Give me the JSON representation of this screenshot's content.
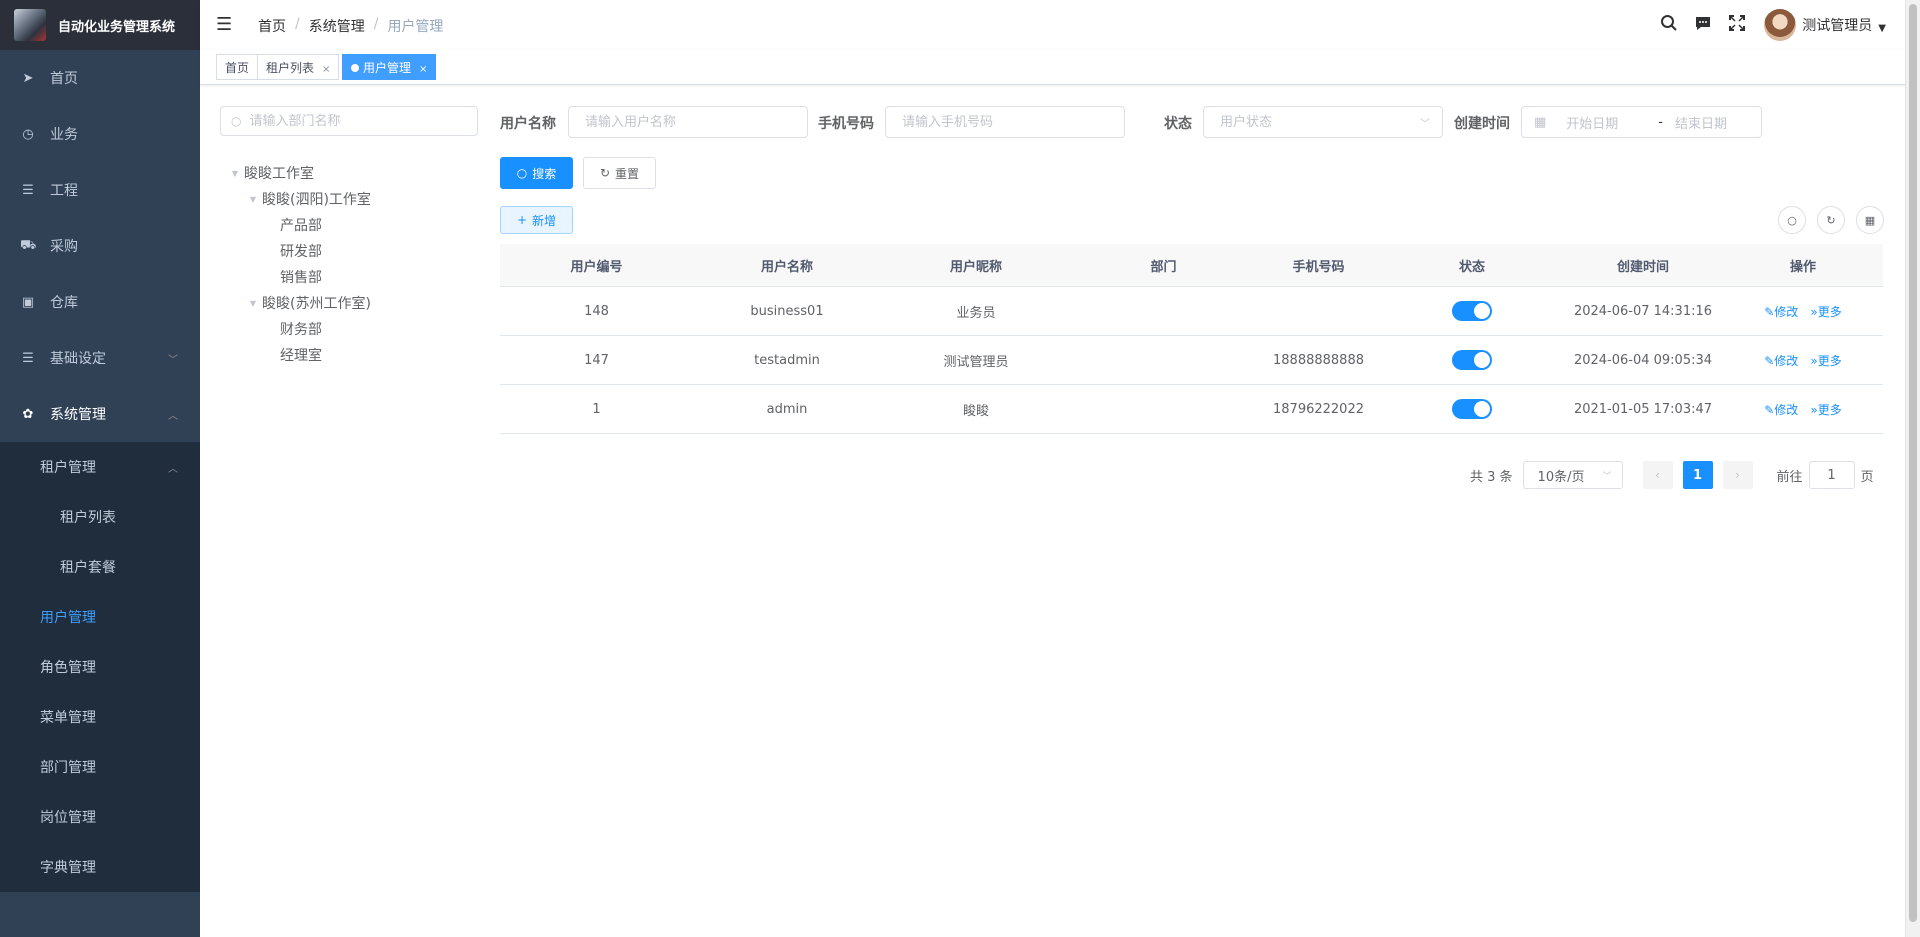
{
  "app": {
    "title": "自动化业务管理系统"
  },
  "sidebar": {
    "items": [
      {
        "label": "首页",
        "icon": "paper-plane-icon"
      },
      {
        "label": "业务",
        "icon": "business-icon"
      },
      {
        "label": "工程",
        "icon": "sliders-icon"
      },
      {
        "label": "采购",
        "icon": "cart-icon"
      },
      {
        "label": "仓库",
        "icon": "briefcase-icon"
      },
      {
        "label": "基础设定",
        "icon": "sliders-icon"
      },
      {
        "label": "系统管理",
        "icon": "gear-icon"
      }
    ],
    "system": {
      "tenant": {
        "label": "租户管理",
        "children": [
          "租户列表",
          "租户套餐"
        ]
      },
      "children": [
        "用户管理",
        "角色管理",
        "菜单管理",
        "部门管理",
        "岗位管理",
        "字典管理"
      ]
    }
  },
  "navbar": {
    "breadcrumb": [
      "首页",
      "系统管理",
      "用户管理"
    ],
    "separator": "/",
    "username": "测试管理员"
  },
  "tags": [
    {
      "label": "首页"
    },
    {
      "label": "租户列表"
    },
    {
      "label": "用户管理"
    }
  ],
  "dept": {
    "search_placeholder": "请输入部门名称",
    "tree": {
      "root": "睃睃工作室",
      "groups": [
        {
          "label": "睃睃(泗阳)工作室",
          "children": [
            "产品部",
            "研发部",
            "销售部"
          ]
        },
        {
          "label": "睃睃(苏州工作室)",
          "children": [
            "财务部",
            "经理室"
          ]
        }
      ]
    }
  },
  "search": {
    "username_label": "用户名称",
    "username_placeholder": "请输入用户名称",
    "phone_label": "手机号码",
    "phone_placeholder": "请输入手机号码",
    "status_label": "状态",
    "status_placeholder": "用户状态",
    "created_label": "创建时间",
    "start_placeholder": "开始日期",
    "range_sep": "-",
    "end_placeholder": "结束日期",
    "search_btn": "搜索",
    "reset_btn": "重置",
    "add_btn": "新增"
  },
  "table": {
    "columns": [
      "用户编号",
      "用户名称",
      "用户昵称",
      "部门",
      "手机号码",
      "状态",
      "创建时间",
      "操作"
    ],
    "rows": [
      {
        "id": "148",
        "username": "business01",
        "nickname": "业务员",
        "dept": "",
        "phone": "",
        "enabled": true,
        "created": "2024-06-07 14:31:16"
      },
      {
        "id": "147",
        "username": "testadmin",
        "nickname": "测试管理员",
        "dept": "",
        "phone": "18888888888",
        "enabled": true,
        "created": "2024-06-04 09:05:34"
      },
      {
        "id": "1",
        "username": "admin",
        "nickname": "睃睃",
        "dept": "",
        "phone": "18796222022",
        "enabled": true,
        "created": "2021-01-05 17:03:47"
      }
    ],
    "edit_label": "修改",
    "more_label": "更多"
  },
  "pagination": {
    "total_text": "共 3 条",
    "page_size": "10条/页",
    "current_page": "1",
    "goto_label": "前往",
    "goto_value": "1",
    "page_suffix": "页"
  },
  "colors": {
    "sidebar_bg": "#304156",
    "accent": "#1890ff",
    "active_menu": "#409eff"
  }
}
